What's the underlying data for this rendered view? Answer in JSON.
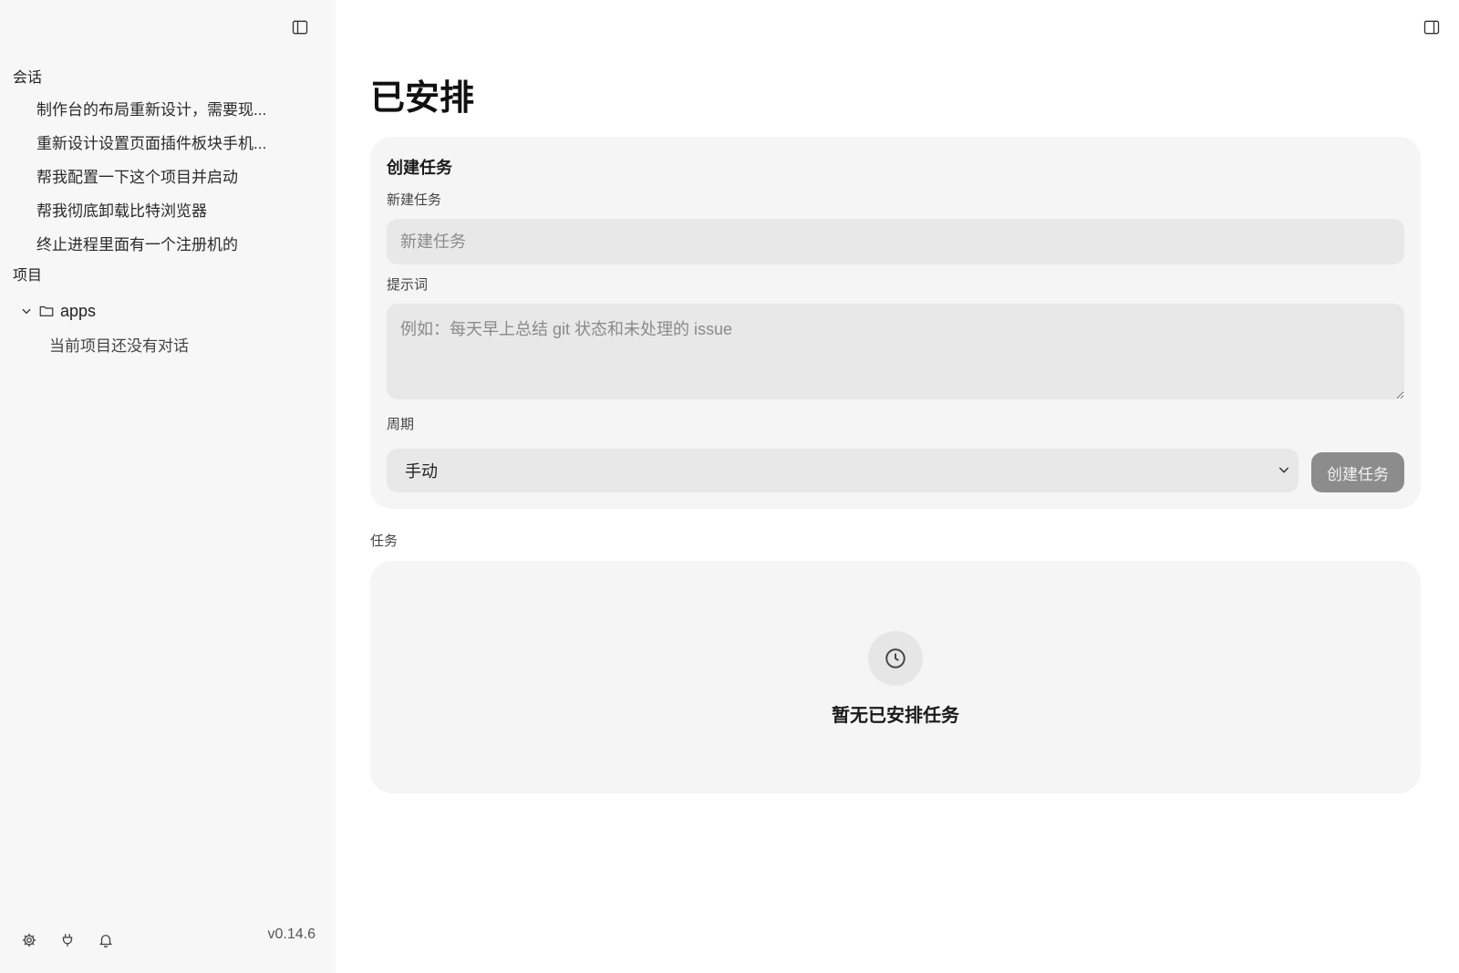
{
  "sidebar": {
    "toggle_icon": "sidebar-left-icon",
    "conversations_heading": "会话",
    "conversations": [
      {
        "label": "制作台的布局重新设计，需要现..."
      },
      {
        "label": "重新设计设置页面插件板块手机..."
      },
      {
        "label": "帮我配置一下这个项目并启动"
      },
      {
        "label": "帮我彻底卸载比特浏览器"
      },
      {
        "label": "终止进程里面有一个注册机的"
      }
    ],
    "projects_heading": "项目",
    "project": {
      "name": "apps",
      "expanded": true,
      "empty_text": "当前项目还没有对话"
    },
    "footer_icons": [
      "gear-icon",
      "plug-icon",
      "bell-icon"
    ],
    "version": "v0.14.6"
  },
  "main": {
    "title": "已安排",
    "right_toggle_icon": "sidebar-right-icon",
    "create_card": {
      "title": "创建任务",
      "name_label": "新建任务",
      "name_placeholder": "新建任务",
      "prompt_label": "提示词",
      "prompt_placeholder": "例如：每天早上总结 git 状态和未处理的 issue",
      "period_label": "周期",
      "period_value": "手动",
      "create_button": "创建任务"
    },
    "tasks_label": "任务",
    "empty_state": {
      "icon": "clock-icon",
      "text": "暂无已安排任务"
    }
  },
  "colors": {
    "sidebar_bg": "#f7f7f7",
    "card_bg": "#f5f5f5",
    "input_bg": "#e8e8e8",
    "button_bg": "#8c8c8c"
  }
}
